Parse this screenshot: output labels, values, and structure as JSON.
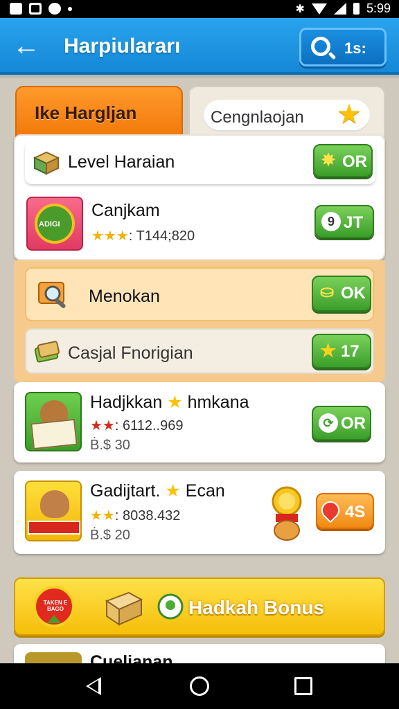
{
  "status_bar": {
    "time": "5:99"
  },
  "app_bar": {
    "title": "Harpiulararı",
    "search_count": "1s:"
  },
  "tabs": [
    {
      "label": "Ike Hargljan",
      "active": true
    },
    {
      "label": "Cengnlaojan",
      "active": false
    }
  ],
  "rows": [
    {
      "title": "Level Haraian",
      "button": "OR"
    },
    {
      "title": "Canjkam",
      "thumb_text": "ADIGI",
      "stars": "★★★",
      "meta": ": T144;820",
      "button": "JT",
      "button_prefix": "9"
    },
    {
      "title": "Menokan",
      "button": "OK"
    },
    {
      "title": "Casjal Fnorigian",
      "button": "17"
    },
    {
      "title": "Hadjkkan",
      "title_suffix": "hmkana",
      "stars": "★★",
      "meta": ": 6112..969",
      "sub": "Ḃ.$ 30",
      "button": "OR"
    },
    {
      "title": "Gadijtart.",
      "title_suffix": "Ecan",
      "stars": "★★",
      "meta": ": 8038.432",
      "sub": "Ḃ.$ 20",
      "button": "4S"
    }
  ],
  "bonus": {
    "label": "Hadkah Bonus",
    "badge_text": "TAKEN E BAGO"
  },
  "partial_row": {
    "title": "Cuelianan"
  },
  "colors": {
    "accent": "#1a8fe0",
    "orange": "#f58a14",
    "green": "#4aad32",
    "yellow": "#ffd62a"
  }
}
